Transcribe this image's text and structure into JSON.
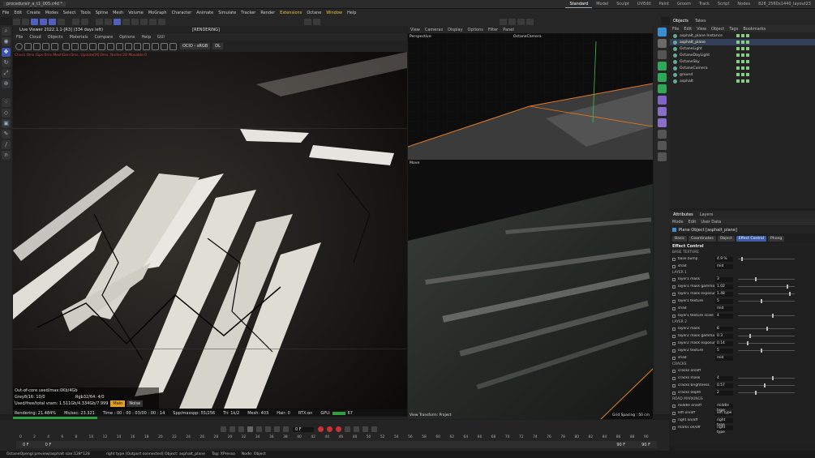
{
  "titlebar": {
    "file": "proceduralr_a_t1_005.c4d *",
    "layouts": [
      "Standard",
      "Model",
      "Sculpt",
      "UVEdit",
      "Paint",
      "Groom",
      "Track",
      "Script",
      "Nodes",
      "828_2560x1440_layout23"
    ],
    "active_layout": "Standard"
  },
  "menu": [
    "File",
    "Edit",
    "Create",
    "Modes",
    "Select",
    "Tools",
    "Spline",
    "Mesh",
    "Volume",
    "MoGraph",
    "Character",
    "Animate",
    "Simulate",
    "Tracker",
    "Render",
    "Extensions",
    "Octane",
    "Window",
    "Help"
  ],
  "menu_highlighted": [
    "Extensions",
    "Window"
  ],
  "live_viewer": {
    "title": "Live Viewer 2022.1.1-[R3] (334 days left)",
    "state": "[RENDERING]",
    "menu": [
      "File",
      "Cloud",
      "Objects",
      "Materials",
      "Compare",
      "Options",
      "Help",
      "GUI"
    ],
    "mode_select": "OCIO - sRGB",
    "dl_select": "DL",
    "info_line": "Check:0ms./Sps:0ms.MeshGen:0ms. Update[M]:0ms. Nodes:28 Movable:0",
    "stats": {
      "out_of_core": "Out-of-core used/max:0Kb/4Gb",
      "grey": "Grey8/16: 10/0",
      "rgb": "Rgb32/64: 4/0",
      "vram": "Used/free/total vram: 1.511Gb/4.334Gb/7.999",
      "badge_main": "Main",
      "badge_noise": "Noise"
    },
    "render_bar": {
      "rendering": "Rendering: 21.484%",
      "ms_sec": "Ms/sec: 23.321",
      "time": "Time : 00 : 00 : 03/00 : 00 : 14",
      "spp": "Spp/maxspp: 55/256",
      "tri": "Tri: 1k/2",
      "mesh": "Mesh: 403",
      "hair": "Hair: 0",
      "rtx": "RTX:on",
      "gpu": "GPU:",
      "gpu_val": "67"
    },
    "progress_percent": 21.484
  },
  "viewport": {
    "menu": [
      "View",
      "Cameras",
      "Display",
      "Options",
      "Filter",
      "Panel"
    ],
    "top_label": "Perspective",
    "top_camera": "OctaneCamera",
    "bottom_label": "Move",
    "view_transform": "View Transform: Project",
    "grid_spacing": "Grid Spacing : 50 cm"
  },
  "objects_panel": {
    "tabs": [
      "Objects",
      "Takes"
    ],
    "menu": [
      "File",
      "Edit",
      "View",
      "Object",
      "Tags",
      "Bookmarks"
    ],
    "items": [
      {
        "name": "asphalt_plane Instance",
        "selected": false
      },
      {
        "name": "asphalt_plane",
        "selected": true
      },
      {
        "name": "OctaneLight",
        "selected": false
      },
      {
        "name": "OctaneDayLight",
        "selected": false
      },
      {
        "name": "OctaneSky",
        "selected": false
      },
      {
        "name": "OctaneCamera",
        "selected": false
      },
      {
        "name": "ground",
        "selected": false
      },
      {
        "name": "asphalt",
        "selected": false
      }
    ]
  },
  "attributes_panel": {
    "tabs": [
      "Attributes",
      "Layers"
    ],
    "menu": [
      "Mode",
      "Edit",
      "User Data"
    ],
    "title": "Plane Object [asphalt_plane]",
    "buttons": [
      "Basic",
      "Coordinates",
      "Object",
      "Effect Control",
      "Phong"
    ],
    "active_button": "Effect Control",
    "section": "Effect Control",
    "groups": [
      {
        "title": "BASE TEXTURE",
        "params": [
          {
            "label": "base bump",
            "value": "4.9 %",
            "slider": 0.05
          },
          {
            "label": "shad",
            "value": "mid",
            "slider": null
          }
        ]
      },
      {
        "title": "LAYER 1",
        "params": [
          {
            "label": "layer1 mask",
            "value": "3",
            "slider": 0.3
          },
          {
            "label": "layer1 mask gamma",
            "value": "1.02",
            "slider": 0.85
          },
          {
            "label": "layer1 mask exposure",
            "value": "1.48",
            "slider": 0.9
          },
          {
            "label": "layer1 texture",
            "value": "5",
            "slider": 0.4
          },
          {
            "label": "shad",
            "value": "mid",
            "slider": null
          },
          {
            "label": "layer1 texture scale",
            "value": "4",
            "slider": 0.6
          }
        ]
      },
      {
        "title": "LAYER 2",
        "params": [
          {
            "label": "layer2 mask",
            "value": "6",
            "slider": 0.5
          },
          {
            "label": "layer2 mask gamma",
            "value": "0.3",
            "slider": 0.2
          },
          {
            "label": "layer2 mask exposure",
            "value": "0.14",
            "slider": 0.15
          },
          {
            "label": "layer2 texture",
            "value": "5",
            "slider": 0.4
          },
          {
            "label": "shad",
            "value": "mid",
            "slider": null
          }
        ]
      },
      {
        "title": "CRACKS",
        "params": [
          {
            "label": "cracks on/off",
            "value": "",
            "slider": null
          },
          {
            "label": "cracks mask",
            "value": "4",
            "slider": 0.6
          },
          {
            "label": "cracks brightness",
            "value": "0.57",
            "slider": 0.45
          },
          {
            "label": "cracks depth",
            "value": "2",
            "slider": 0.3
          }
        ]
      },
      {
        "title": "ROAD MARKINGS",
        "params": [
          {
            "label": "middle on/off",
            "value": "middle type",
            "slider": null
          },
          {
            "label": "left on/off",
            "value": "left type",
            "slider": null
          },
          {
            "label": "right on/off",
            "value": "right type",
            "slider": null
          },
          {
            "label": "marks on/off",
            "value": "right type",
            "slider": null
          }
        ]
      }
    ]
  },
  "timeline": {
    "frame_field": "0 F",
    "start": "0 F",
    "start2": "0 F",
    "end": "90 F",
    "end2": "90 F",
    "ticks": [
      "0",
      "2",
      "4",
      "6",
      "8",
      "10",
      "12",
      "14",
      "16",
      "18",
      "20",
      "22",
      "24",
      "26",
      "28",
      "30",
      "32",
      "34",
      "36",
      "38",
      "40",
      "42",
      "44",
      "46",
      "48",
      "50",
      "52",
      "54",
      "56",
      "58",
      "60",
      "62",
      "64",
      "66",
      "68",
      "70",
      "72",
      "74",
      "76",
      "78",
      "80",
      "82",
      "84",
      "86",
      "88",
      "90"
    ]
  },
  "statusbar": {
    "left": "OctaneOpengl preview/asphalt size:128*128",
    "mid": "right type [Outport connected] Object: asphalt_plane",
    "tag": "Tag: XPresso",
    "node": "Node: Object"
  },
  "colors": {
    "accent": "#3d5aa8",
    "selection": "#34405a",
    "progress": "#2ea043",
    "highlight": "#f0c040",
    "orange_edge": "#e07820"
  }
}
